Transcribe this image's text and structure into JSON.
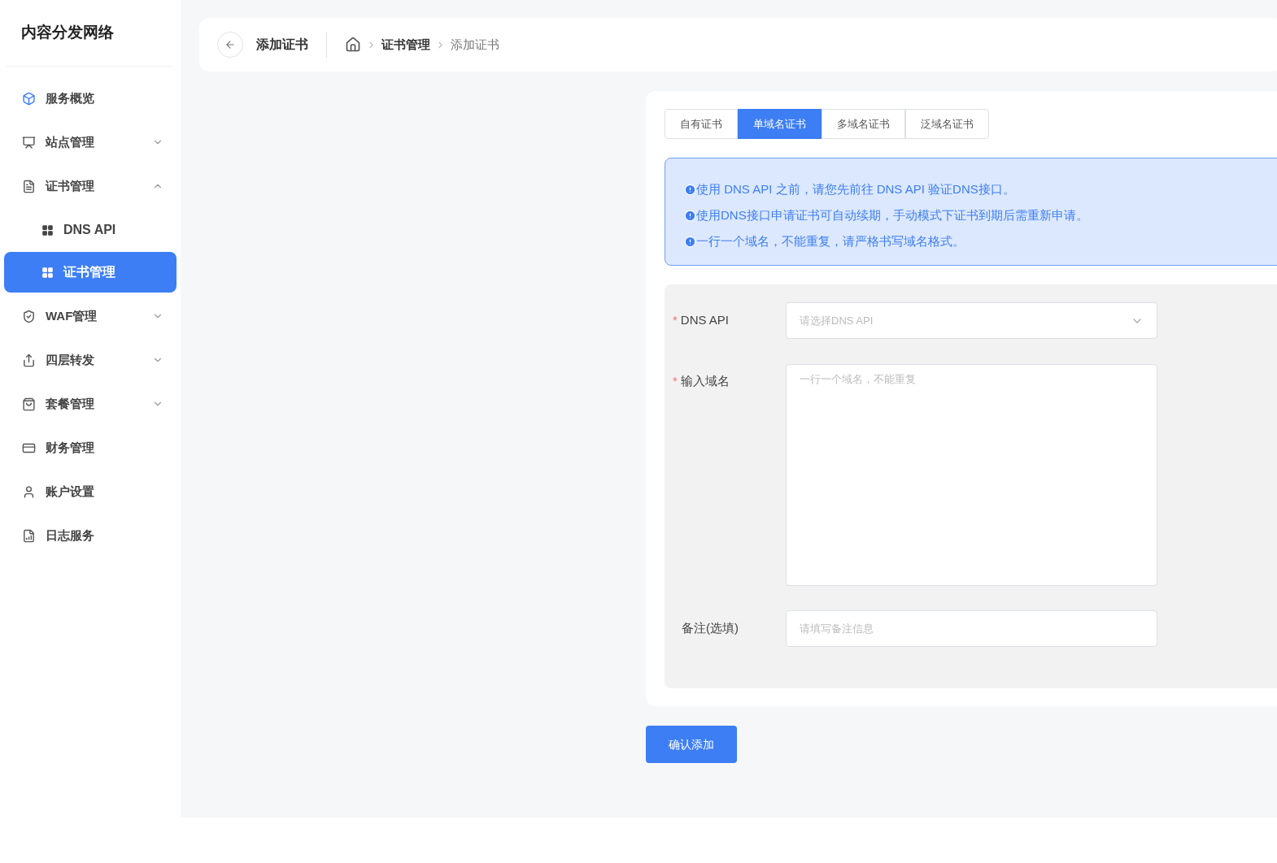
{
  "sidebar": {
    "title": "内容分发网络",
    "items": [
      {
        "label": "服务概览",
        "selected": false
      },
      {
        "label": "站点管理",
        "selected": false,
        "expanded": false
      },
      {
        "label": "证书管理",
        "selected": false,
        "expanded": true,
        "children": [
          {
            "label": "DNS API",
            "selected": false
          },
          {
            "label": "证书管理",
            "selected": true
          }
        ]
      },
      {
        "label": "WAF管理",
        "selected": false,
        "expanded": false
      },
      {
        "label": "四层转发",
        "selected": false,
        "expanded": false
      },
      {
        "label": "套餐管理",
        "selected": false,
        "expanded": false
      },
      {
        "label": "财务管理",
        "selected": false
      },
      {
        "label": "账户设置",
        "selected": false
      },
      {
        "label": "日志服务",
        "selected": false
      }
    ]
  },
  "header": {
    "title": "添加证书",
    "breadcrumb": [
      "证书管理",
      "添加证书"
    ]
  },
  "tabs": [
    {
      "label": "自有证书",
      "selected": false
    },
    {
      "label": "单域名证书",
      "selected": true
    },
    {
      "label": "多域名证书",
      "selected": false
    },
    {
      "label": "泛域名证书",
      "selected": false
    }
  ],
  "notices": [
    "使用 DNS API 之前，请您先前往 DNS API 验证DNS接口。",
    "使用DNS接口申请证书可自动续期，手动模式下证书到期后需重新申请。",
    "一行一个域名，不能重复，请严格书写域名格式。"
  ],
  "form": [
    {
      "label": "DNS API",
      "required_mark": "*",
      "kind": "select",
      "placeholder": "请选择DNS API"
    },
    {
      "label": "输入域名",
      "required_mark": "*",
      "kind": "textarea",
      "placeholder": "一行一个域名，不能重复"
    },
    {
      "label": "备注(选填)",
      "kind": "input",
      "placeholder": "请填写备注信息"
    }
  ],
  "submit": "确认添加"
}
